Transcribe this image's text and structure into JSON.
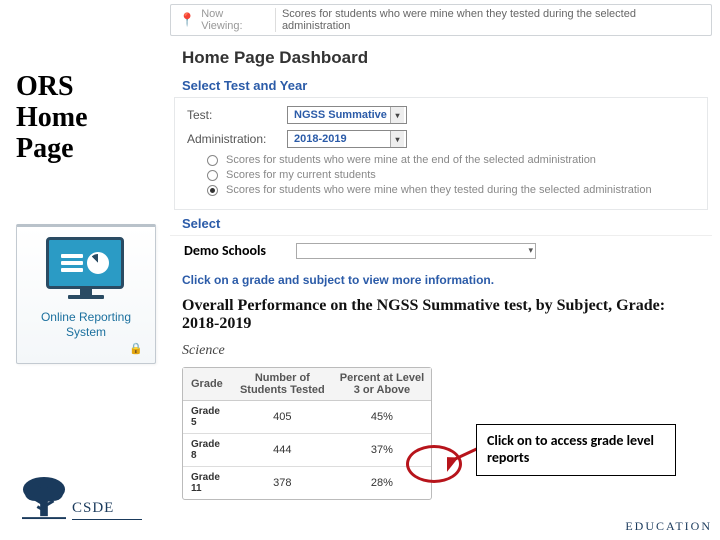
{
  "left": {
    "title": "ORS\nHome\nPage",
    "card_label": "Online Reporting System",
    "csde": "CSDE"
  },
  "now_viewing": {
    "label": "Now Viewing:",
    "text": "Scores for students who were mine when they tested during the selected administration"
  },
  "dashboard_title": "Home Page Dashboard",
  "section_test_year": "Select Test and Year",
  "form": {
    "test_label": "Test:",
    "test_value": "NGSS Summative",
    "admin_label": "Administration:",
    "admin_value": "2018-2019"
  },
  "radios": {
    "opt1": "Scores for students who were mine at the end of the selected administration",
    "opt2": "Scores for my current students",
    "opt3": "Scores for students who were mine when they tested during the selected administration"
  },
  "section_select": "Select",
  "demo_schools": "Demo Schools",
  "hint": "Click on a grade and subject to view more information.",
  "overall_title": "Overall Performance on the NGSS Summative test, by Subject, Grade: 2018-2019",
  "science": "Science",
  "table": {
    "h_grade": "Grade",
    "h_num": "Number of Students Tested",
    "h_pct": "Percent at Level 3 or Above",
    "rows": [
      {
        "g": "Grade 5",
        "n": "405",
        "p": "45%"
      },
      {
        "g": "Grade 8",
        "n": "444",
        "p": "37%"
      },
      {
        "g": "Grade 11",
        "n": "378",
        "p": "28%"
      }
    ]
  },
  "callout": "Click on to access grade level reports",
  "footer": "EDUCATION",
  "chart_data": {
    "type": "table",
    "title": "Overall Performance on the NGSS Summative test, by Subject, Grade: 2018-2019",
    "subject": "Science",
    "columns": [
      "Grade",
      "Number of Students Tested",
      "Percent at Level 3 or Above"
    ],
    "rows": [
      [
        "Grade 5",
        405,
        "45%"
      ],
      [
        "Grade 8",
        444,
        "37%"
      ],
      [
        "Grade 11",
        378,
        "28%"
      ]
    ]
  }
}
